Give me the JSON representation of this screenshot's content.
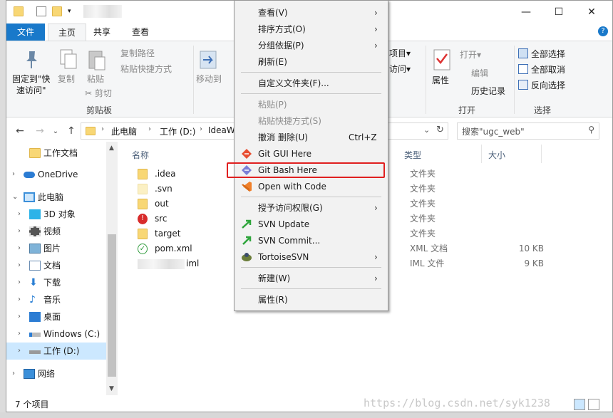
{
  "window": {
    "controls": {
      "minimize": "—",
      "maximize": "☐",
      "close": "✕"
    },
    "help": "?"
  },
  "ribbon_tabs": [
    "文件",
    "主页",
    "共享",
    "查看"
  ],
  "ribbon": {
    "pin_label_1": "固定到\"快",
    "pin_label_2": "速访问\"",
    "copy": "复制",
    "paste": "粘贴",
    "copy_path": "复制路径",
    "paste_shortcut": "粘贴快捷方式",
    "cut": "剪切",
    "clipboard_group": "剪贴板",
    "move_to": "移动到",
    "new_item": "项目▾",
    "easy_access": "访问▾",
    "properties": "属性",
    "open": "打开▾",
    "edit": "编辑",
    "history": "历史记录",
    "open_group": "打开",
    "select_all": "全部选择",
    "select_none": "全部取消",
    "invert_selection": "反向选择",
    "select_group": "选择"
  },
  "address": {
    "crumbs": [
      "此电脑",
      "工作 (D:)",
      "IdeaW"
    ],
    "search_placeholder": "搜索\"ugc_web\""
  },
  "nav": {
    "items": [
      {
        "label": "工作文档",
        "icon": "folder-icon"
      },
      {
        "label": "OneDrive",
        "icon": "onedrive-icon"
      },
      {
        "label": "此电脑",
        "icon": "this-pc-icon"
      },
      {
        "label": "3D 对象",
        "icon": "3d-objects-icon"
      },
      {
        "label": "视频",
        "icon": "video-icon"
      },
      {
        "label": "图片",
        "icon": "pictures-icon"
      },
      {
        "label": "文档",
        "icon": "documents-icon"
      },
      {
        "label": "下载",
        "icon": "download-icon"
      },
      {
        "label": "音乐",
        "icon": "music-icon"
      },
      {
        "label": "桌面",
        "icon": "desktop-icon"
      },
      {
        "label": "Windows (C:)",
        "icon": "drive-icon"
      },
      {
        "label": "工作 (D:)",
        "icon": "drive-icon"
      },
      {
        "label": "网络",
        "icon": "network-icon"
      }
    ]
  },
  "files": {
    "headers": {
      "name": "名称",
      "type": "类型",
      "size": "大小"
    },
    "rows": [
      {
        "name": ".idea",
        "type": "文件夹",
        "size": ""
      },
      {
        "name": ".svn",
        "type": "文件夹",
        "size": ""
      },
      {
        "name": "out",
        "type": "文件夹",
        "size": ""
      },
      {
        "name": "src",
        "type": "文件夹",
        "size": ""
      },
      {
        "name": "target",
        "type": "文件夹",
        "size": ""
      },
      {
        "name": "pom.xml",
        "type": "XML 文档",
        "size": "10 KB"
      },
      {
        "name": "iml",
        "type": "IML 文件",
        "size": "9 KB"
      }
    ]
  },
  "status": {
    "count": "7 个项目"
  },
  "context_menu": {
    "view": "查看(V)",
    "sort": "排序方式(O)",
    "group": "分组依据(P)",
    "refresh": "刷新(E)",
    "customize": "自定义文件夹(F)...",
    "paste": "粘贴(P)",
    "paste_shortcut": "粘贴快捷方式(S)",
    "undo_delete": "撤消 删除(U)",
    "undo_shortcut": "Ctrl+Z",
    "git_gui": "Git GUI Here",
    "git_bash": "Git Bash Here",
    "open_with_code": "Open with Code",
    "grant_access": "授予访问权限(G)",
    "svn_update": "SVN Update",
    "svn_commit": "SVN Commit...",
    "tortoise": "TortoiseSVN",
    "new": "新建(W)",
    "properties": "属性(R)"
  },
  "watermark": "https://blog.csdn.net/syk1238",
  "colors": {
    "accent": "#1979ca",
    "highlight": "#e02020",
    "selection": "#cce8ff"
  }
}
